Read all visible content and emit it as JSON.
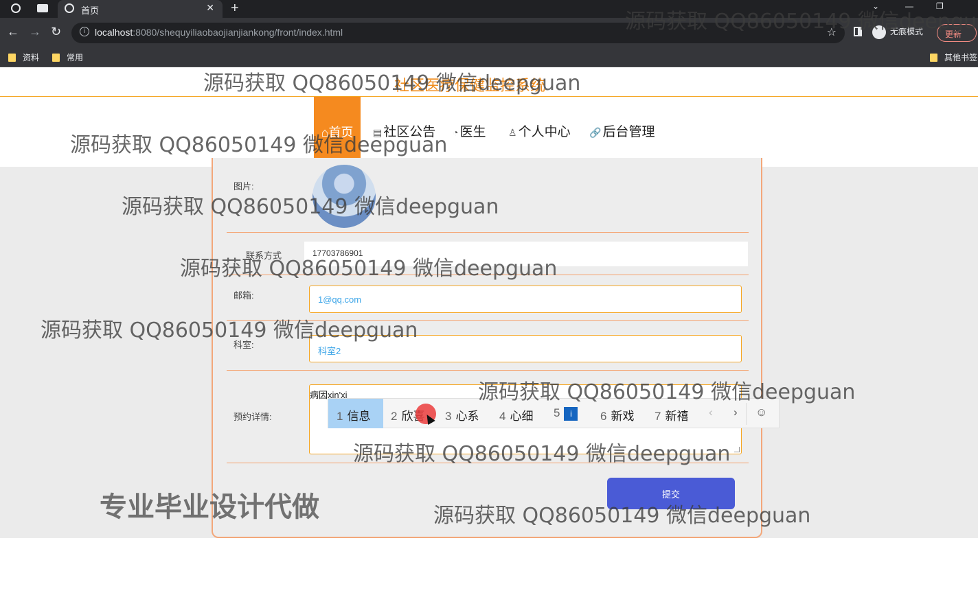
{
  "browser": {
    "tab_title": "首页",
    "url_host": "localhost",
    "url_rest": ":8080/shequyiliaobaojianjiankong/front/index.html",
    "incognito_label": "无痕模式",
    "update_label": "更新",
    "bookmarks": [
      "资料",
      "常用"
    ],
    "other_bookmarks": "其他书签"
  },
  "site": {
    "title": "社区医疗保健监控系统",
    "nav": [
      {
        "label": "首页",
        "icon": "home-icon"
      },
      {
        "label": "社区公告",
        "icon": "notice-icon"
      },
      {
        "label": "医生",
        "icon": "dashboard-icon"
      },
      {
        "label": "个人中心",
        "icon": "user-icon"
      },
      {
        "label": "后台管理",
        "icon": "link-icon"
      }
    ]
  },
  "form": {
    "image_label": "图片:",
    "contact_label": "联系方式",
    "contact_value": "17703786901",
    "email_label": "邮箱:",
    "email_value": "1@qq.com",
    "dept_label": "科室:",
    "dept_value": "科室2",
    "detail_label": "预约详情:",
    "detail_prefix": "病因",
    "detail_composing": "xin'xi",
    "submit_label": "提交"
  },
  "ime": {
    "candidates": [
      {
        "num": "1",
        "text": "信息"
      },
      {
        "num": "2",
        "text": "欣喜"
      },
      {
        "num": "3",
        "text": "心系"
      },
      {
        "num": "4",
        "text": "心细"
      },
      {
        "num": "5",
        "text": "i"
      },
      {
        "num": "6",
        "text": "新戏"
      },
      {
        "num": "7",
        "text": "新禧"
      }
    ]
  },
  "watermarks": {
    "text": "源码获取 QQ86050149 微信deepguan",
    "promo": "专业毕业设计代做"
  },
  "colors": {
    "accent": "#f58a1f",
    "submit": "#4a5bd6",
    "input_text": "#3ea6e8"
  }
}
